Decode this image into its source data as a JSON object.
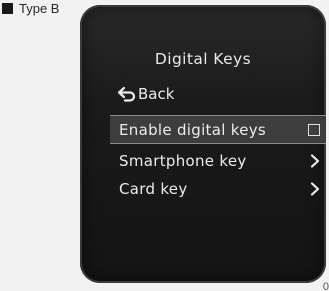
{
  "type_label": "Type B",
  "screen": {
    "title": "Digital Keys",
    "back_label": "Back",
    "menu": [
      {
        "label": "Enable digital keys",
        "control": "checkbox",
        "checked": false,
        "selected": true
      },
      {
        "label": "Smartphone key",
        "control": "chevron",
        "selected": false
      },
      {
        "label": "Card key",
        "control": "chevron",
        "selected": false
      }
    ]
  },
  "corner_text": "0",
  "icons": {
    "back": "back-arrow-icon",
    "checkbox": "checkbox-icon",
    "chevron": "chevron-right-icon"
  }
}
